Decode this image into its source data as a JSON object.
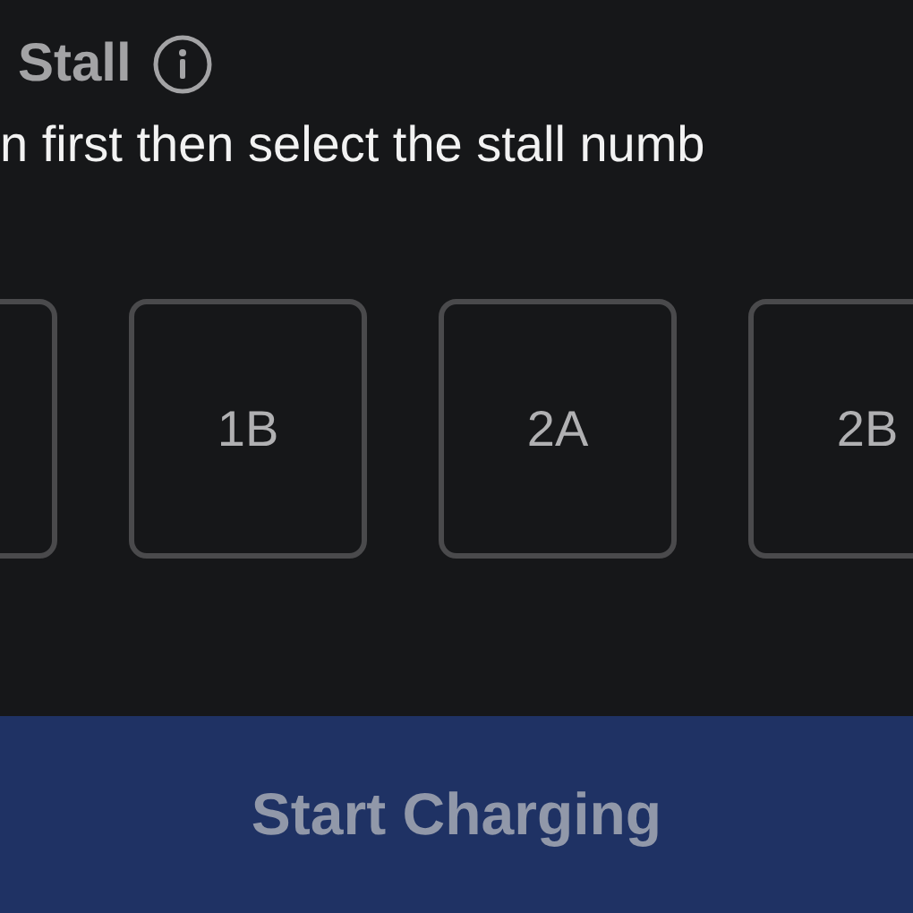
{
  "header": {
    "title": "Stall"
  },
  "instruction": "n first then select the stall numb",
  "stalls": [
    {
      "kind": "cut_off"
    },
    {
      "kind": "stall",
      "label": "1B"
    },
    {
      "kind": "stall",
      "label": "2A"
    },
    {
      "kind": "stall",
      "label": "2B"
    }
  ],
  "start_button": {
    "label": "Start Charging",
    "disabled": true
  }
}
